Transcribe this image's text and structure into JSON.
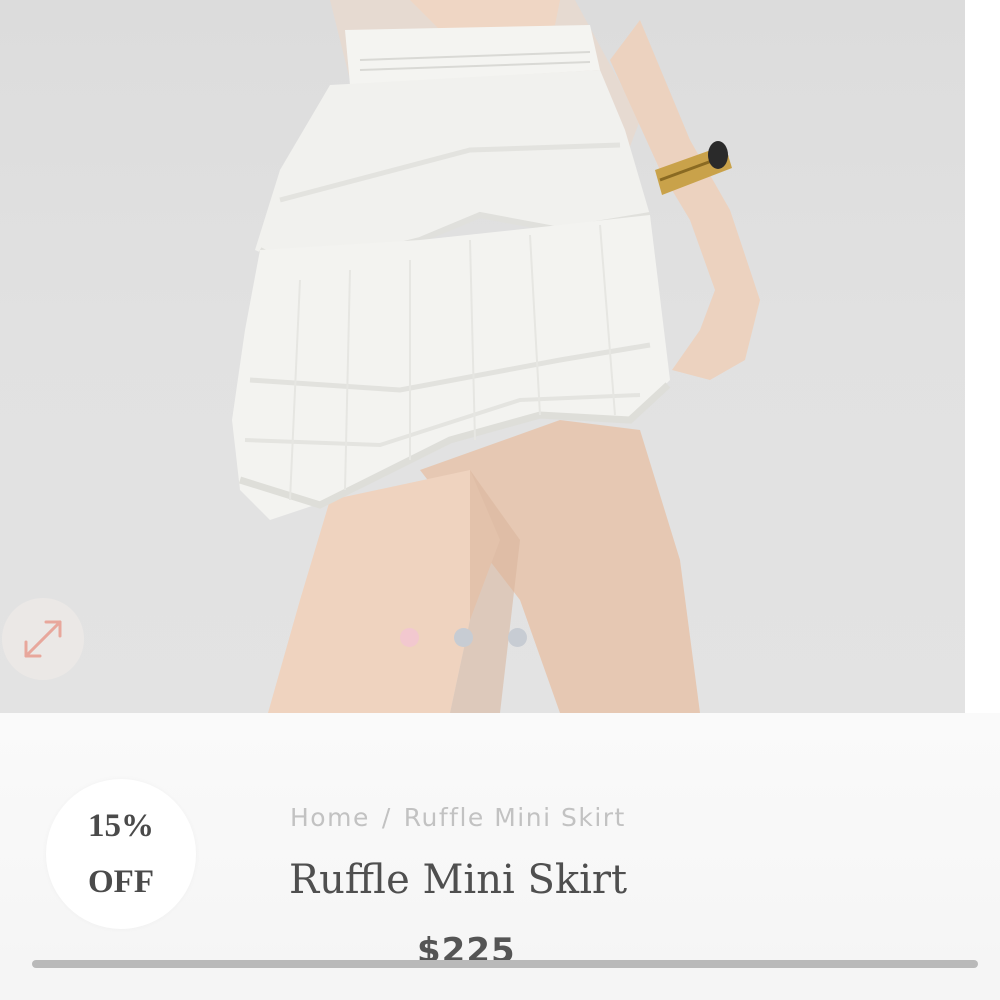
{
  "gallery": {
    "image_alt": "Ruffle Mini Skirt",
    "expand_icon": "expand-arrows-icon",
    "slides": 3,
    "active_slide": 1,
    "colors": {
      "active_dot": "#f2c8cf",
      "inactive_dot": "#c7ccd3",
      "expand_arrow": "#e8a79c"
    }
  },
  "promo": {
    "line1": "15%",
    "line2": "OFF"
  },
  "breadcrumb": {
    "home": "Home",
    "separator": "/",
    "current": "Ruffle Mini Skirt"
  },
  "product": {
    "title": "Ruffle Mini Skirt",
    "price": "$225"
  }
}
